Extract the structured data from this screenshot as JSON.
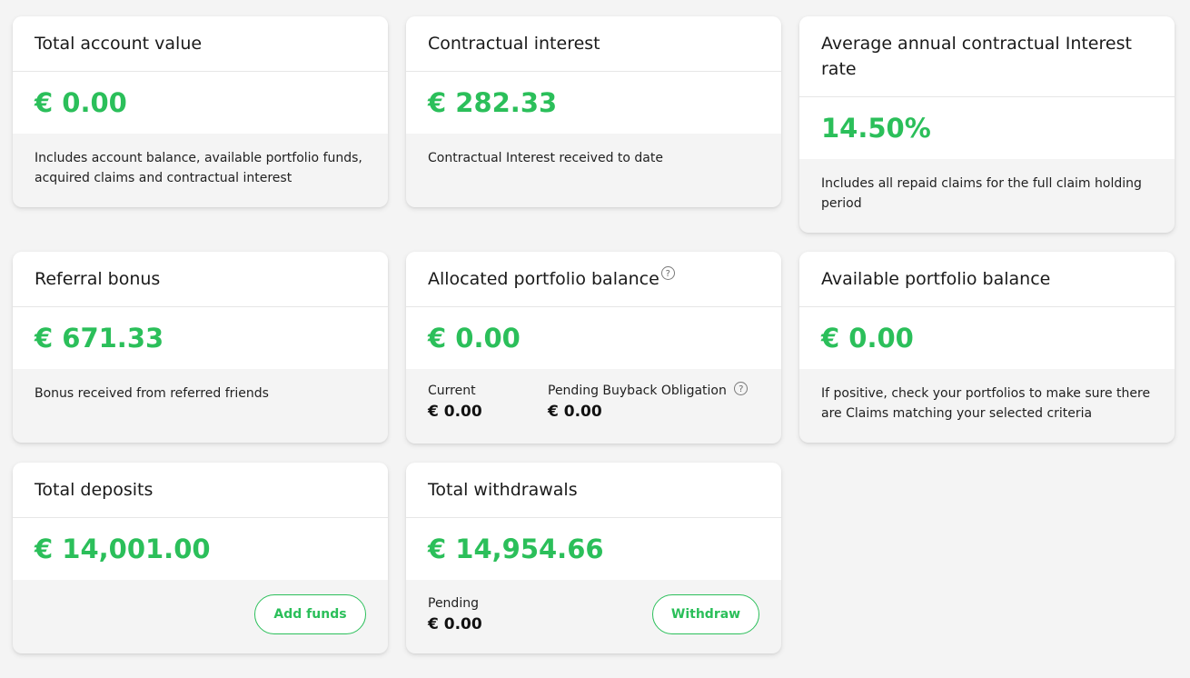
{
  "colors": {
    "accent": "#2bbf5a",
    "background": "#f4f4f4",
    "card": "#ffffff"
  },
  "cards": {
    "total_account_value": {
      "title": "Total account value",
      "value": "€ 0.00",
      "description": "Includes account balance, available portfolio funds, acquired claims and contractual interest"
    },
    "contractual_interest": {
      "title": "Contractual interest",
      "value": "€ 282.33",
      "description": "Contractual Interest received to date"
    },
    "avg_interest_rate": {
      "title": "Average annual contractual Interest rate",
      "value": "14.50%",
      "description": "Includes all repaid claims for the full claim holding period"
    },
    "referral_bonus": {
      "title": "Referral bonus",
      "value": "€ 671.33",
      "description": "Bonus received from referred friends"
    },
    "allocated_portfolio": {
      "title": "Allocated portfolio balance",
      "value": "€ 0.00",
      "current_label": "Current",
      "current_value": "€ 0.00",
      "pending_label": "Pending Buyback Obligation",
      "pending_value": "€ 0.00"
    },
    "available_portfolio": {
      "title": "Available portfolio balance",
      "value": "€ 0.00",
      "description": "If positive, check your portfolios to make sure there are Claims matching your selected criteria"
    },
    "total_deposits": {
      "title": "Total deposits",
      "value": "€ 14,001.00",
      "button_label": "Add funds"
    },
    "total_withdrawals": {
      "title": "Total withdrawals",
      "value": "€ 14,954.66",
      "pending_label": "Pending",
      "pending_value": "€ 0.00",
      "button_label": "Withdraw"
    }
  },
  "icons": {
    "help": "question-circle-icon",
    "help_glyph": "?"
  }
}
